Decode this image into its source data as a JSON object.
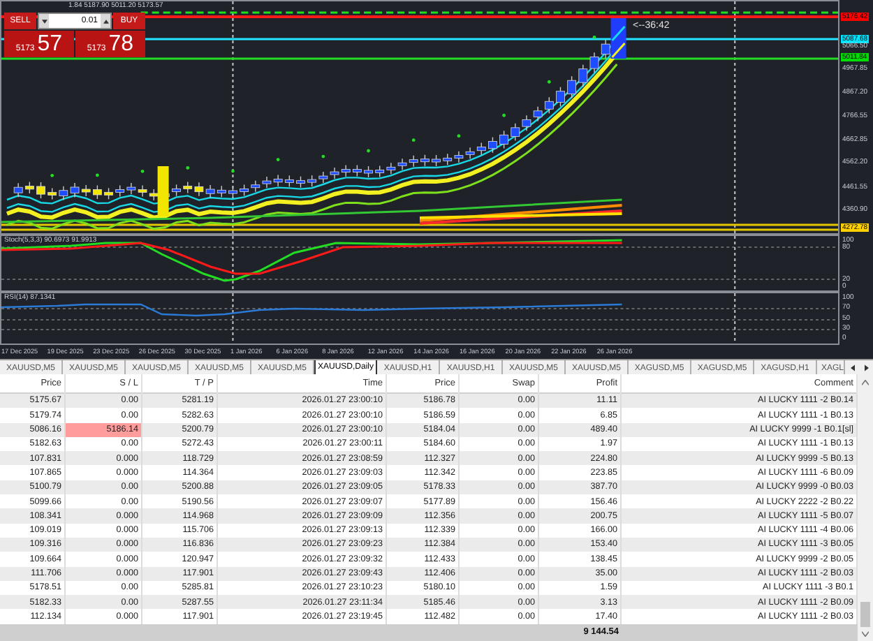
{
  "chart": {
    "header": "1.84 5187.90 5011.20 5173.57",
    "trade_panel": {
      "sell": "SELL",
      "lot": "0.01",
      "buy": "BUY",
      "bid_prefix": "5173",
      "bid_main": "57",
      "ask_prefix": "5173",
      "ask_main": "78"
    },
    "countdown": "<--36:42",
    "price_axis": [
      {
        "text": "5176.42",
        "color": "#ff0000"
      },
      {
        "text": "5087.68",
        "color": "#00e5ff"
      },
      {
        "text": "5066.50"
      },
      {
        "text": "5011.84",
        "color": "#00dd00"
      },
      {
        "text": "4967.85"
      },
      {
        "text": "4867.20"
      },
      {
        "text": "4766.55"
      },
      {
        "text": "4662.85"
      },
      {
        "text": "4562.20"
      },
      {
        "text": "4461.55"
      },
      {
        "text": "4360.90"
      },
      {
        "text": "4272.78",
        "color": "#ffd000"
      }
    ],
    "stochastic": {
      "label": "Stoch(5,3,3) 90.6973 91.9913",
      "axis": [
        "100",
        "80",
        "20",
        "0"
      ]
    },
    "rsi": {
      "label": "RSI(14) 87.1341",
      "axis": [
        "100",
        "70",
        "50",
        "30",
        "0"
      ]
    },
    "time_axis": [
      "17 Dec 2025",
      "19 Dec 2025",
      "23 Dec 2025",
      "26 Dec 2025",
      "30 Dec 2025",
      "1 Jan 2026",
      "6 Jan 2026",
      "8 Jan 2026",
      "12 Jan 2026",
      "14 Jan 2026",
      "16 Jan 2026",
      "20 Jan 2026",
      "22 Jan 2026",
      "26 Jan 2026"
    ]
  },
  "tabs": [
    {
      "label": "XAUUSD,M5",
      "selected": false
    },
    {
      "label": "XAUUSD,M5",
      "selected": false
    },
    {
      "label": "XAUUSD,M5",
      "selected": false
    },
    {
      "label": "XAUUSD,M5",
      "selected": false
    },
    {
      "label": "XAUUSD,M5",
      "selected": false
    },
    {
      "label": "XAUUSD,Daily",
      "selected": true
    },
    {
      "label": "XAUUSD,H1",
      "selected": false
    },
    {
      "label": "XAUUSD,H1",
      "selected": false
    },
    {
      "label": "XAUUSD,M5",
      "selected": false
    },
    {
      "label": "XAUUSD,M5",
      "selected": false
    },
    {
      "label": "XAGUSD,M5",
      "selected": false
    },
    {
      "label": "XAGUSD,M5",
      "selected": false
    },
    {
      "label": "XAGUSD,H1",
      "selected": false
    },
    {
      "label": "XAGL",
      "selected": false
    }
  ],
  "table": {
    "columns": [
      "Price",
      "S / L",
      "T / P",
      "Time",
      "Price",
      "Swap",
      "Profit",
      "Comment"
    ],
    "rows": [
      {
        "cells": [
          "5175.67",
          "0.00",
          "5281.19",
          "2026.01.27 23:00:10",
          "5186.78",
          "0.00",
          "11.11",
          "AI LUCKY 1111 -2 B0.14"
        ],
        "sl_highlight": false
      },
      {
        "cells": [
          "5179.74",
          "0.00",
          "5282.63",
          "2026.01.27 23:00:10",
          "5186.59",
          "0.00",
          "6.85",
          "AI LUCKY 1111 -1 B0.13"
        ],
        "sl_highlight": false
      },
      {
        "cells": [
          "5086.16",
          "5186.14",
          "5200.79",
          "2026.01.27 23:00:10",
          "5184.04",
          "0.00",
          "489.40",
          "AI LUCKY 9999 -1 B0.1[sl]"
        ],
        "sl_highlight": true
      },
      {
        "cells": [
          "5182.63",
          "0.00",
          "5272.43",
          "2026.01.27 23:00:11",
          "5184.60",
          "0.00",
          "1.97",
          "AI LUCKY 1111 -1 B0.13"
        ],
        "sl_highlight": false
      },
      {
        "cells": [
          "107.831",
          "0.000",
          "118.729",
          "2026.01.27 23:08:59",
          "112.327",
          "0.00",
          "224.80",
          "AI LUCKY 9999 -5 B0.13"
        ],
        "sl_highlight": false
      },
      {
        "cells": [
          "107.865",
          "0.000",
          "114.364",
          "2026.01.27 23:09:03",
          "112.342",
          "0.00",
          "223.85",
          "AI LUCKY 1111 -6 B0.09"
        ],
        "sl_highlight": false
      },
      {
        "cells": [
          "5100.79",
          "0.00",
          "5200.88",
          "2026.01.27 23:09:05",
          "5178.33",
          "0.00",
          "387.70",
          "AI LUCKY 9999 -0 B0.03"
        ],
        "sl_highlight": false
      },
      {
        "cells": [
          "5099.66",
          "0.00",
          "5190.56",
          "2026.01.27 23:09:07",
          "5177.89",
          "0.00",
          "156.46",
          "AI LUCKY 2222 -2 B0.22"
        ],
        "sl_highlight": false
      },
      {
        "cells": [
          "108.341",
          "0.000",
          "114.968",
          "2026.01.27 23:09:09",
          "112.356",
          "0.00",
          "200.75",
          "AI LUCKY 1111 -5 B0.07"
        ],
        "sl_highlight": false
      },
      {
        "cells": [
          "109.019",
          "0.000",
          "115.706",
          "2026.01.27 23:09:13",
          "112.339",
          "0.00",
          "166.00",
          "AI LUCKY 1111 -4 B0.06"
        ],
        "sl_highlight": false
      },
      {
        "cells": [
          "109.316",
          "0.000",
          "116.836",
          "2026.01.27 23:09:23",
          "112.384",
          "0.00",
          "153.40",
          "AI LUCKY 1111 -3 B0.05"
        ],
        "sl_highlight": false
      },
      {
        "cells": [
          "109.664",
          "0.000",
          "120.947",
          "2026.01.27 23:09:32",
          "112.433",
          "0.00",
          "138.45",
          "AI LUCKY 9999 -2 B0.05"
        ],
        "sl_highlight": false
      },
      {
        "cells": [
          "111.706",
          "0.000",
          "117.901",
          "2026.01.27 23:09:43",
          "112.406",
          "0.00",
          "35.00",
          "AI LUCKY 1111 -2 B0.03"
        ],
        "sl_highlight": false
      },
      {
        "cells": [
          "5178.51",
          "0.00",
          "5285.81",
          "2026.01.27 23:10:23",
          "5180.10",
          "0.00",
          "1.59",
          "AI LUCKY 1111 -3 B0.1"
        ],
        "sl_highlight": false
      },
      {
        "cells": [
          "5182.33",
          "0.00",
          "5287.55",
          "2026.01.27 23:11:34",
          "5185.46",
          "0.00",
          "3.13",
          "AI LUCKY 1111 -2 B0.09"
        ],
        "sl_highlight": false
      },
      {
        "cells": [
          "112.134",
          "0.000",
          "117.901",
          "2026.01.27 23:19:45",
          "112.482",
          "0.00",
          "17.40",
          "AI LUCKY 1111 -2 B0.03"
        ],
        "sl_highlight": false
      }
    ],
    "total_profit": "9 144.54"
  }
}
